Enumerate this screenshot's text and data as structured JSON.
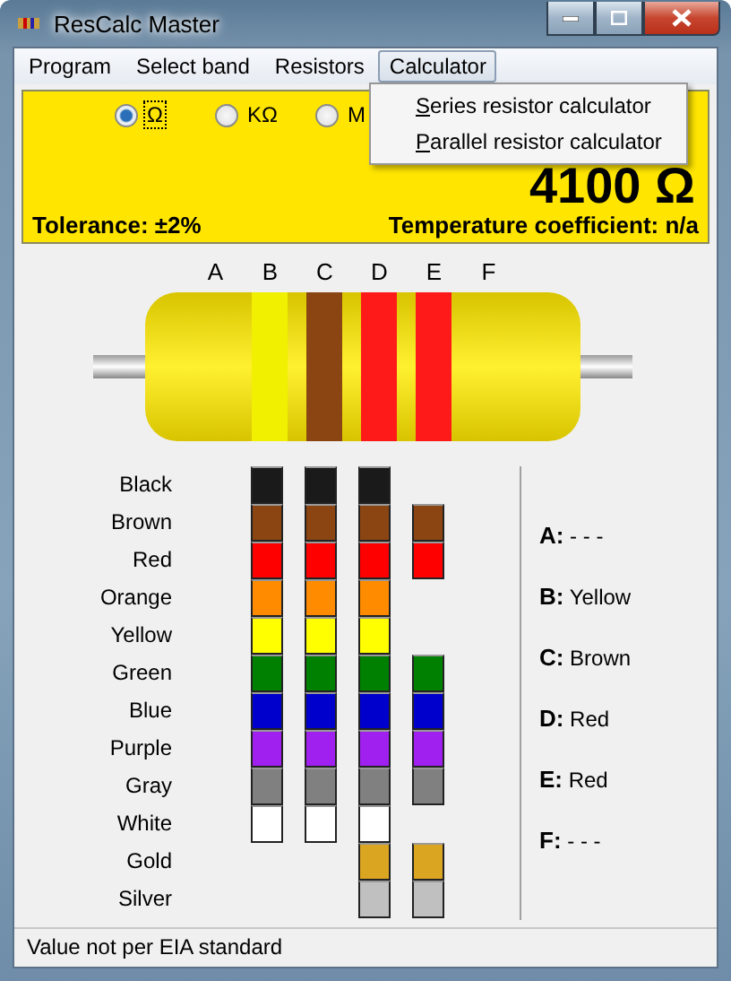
{
  "window": {
    "title": "ResCalc Master"
  },
  "menu": [
    {
      "label": "Program",
      "selected": false
    },
    {
      "label": "Select band",
      "selected": false
    },
    {
      "label": "Resistors",
      "selected": false
    },
    {
      "label": "Calculator",
      "selected": true
    }
  ],
  "dropdown": [
    {
      "label": "Series resistor calculator",
      "underline_first": true
    },
    {
      "label": "Parallel resistor calculator",
      "underline_first": true
    }
  ],
  "units": [
    {
      "label": "Ω",
      "selected": true
    },
    {
      "label": "KΩ",
      "selected": false
    },
    {
      "label": "M",
      "selected": false
    }
  ],
  "value": "4100 Ω",
  "tolerance": "Tolerance: ±2%",
  "temperature": "Temperature coefficient: n/a",
  "bands": [
    {
      "label": "A"
    },
    {
      "label": "B",
      "color": "#f0f000"
    },
    {
      "label": "C",
      "color": "#8b4513"
    },
    {
      "label": "D",
      "color": "#ff1a1a"
    },
    {
      "label": "E",
      "color": "#ff1a1a"
    },
    {
      "label": "F"
    }
  ],
  "palette": [
    {
      "name": "Black",
      "color": "#1a1a1a"
    },
    {
      "name": "Brown",
      "color": "#8b4513"
    },
    {
      "name": "Red",
      "color": "#ff0000"
    },
    {
      "name": "Orange",
      "color": "#ff8c00"
    },
    {
      "name": "Yellow",
      "color": "#ffff00"
    },
    {
      "name": "Green",
      "color": "#008000"
    },
    {
      "name": "Blue",
      "color": "#0000cd"
    },
    {
      "name": "Purple",
      "color": "#a020f0"
    },
    {
      "name": "Gray",
      "color": "#808080"
    },
    {
      "name": "White",
      "color": "#ffffff"
    },
    {
      "name": "Gold",
      "color": "#daa520"
    },
    {
      "name": "Silver",
      "color": "#c0c0c0"
    }
  ],
  "swatch_columns": [
    {
      "available": [
        true,
        true,
        true,
        true,
        true,
        true,
        true,
        true,
        true,
        true,
        false,
        false
      ]
    },
    {
      "available": [
        true,
        true,
        true,
        true,
        true,
        true,
        true,
        true,
        true,
        true,
        false,
        false
      ]
    },
    {
      "available": [
        true,
        true,
        true,
        true,
        true,
        true,
        true,
        true,
        true,
        true,
        true,
        true
      ]
    },
    {
      "available": [
        false,
        true,
        true,
        false,
        false,
        true,
        true,
        true,
        true,
        false,
        true,
        true
      ]
    }
  ],
  "readouts": [
    "**A:** - - -",
    "**B:** Yellow",
    "**C:** Brown",
    "**D:** Red",
    "**E:** Red",
    "**F:** - - -"
  ],
  "status": "Value not per EIA standard"
}
